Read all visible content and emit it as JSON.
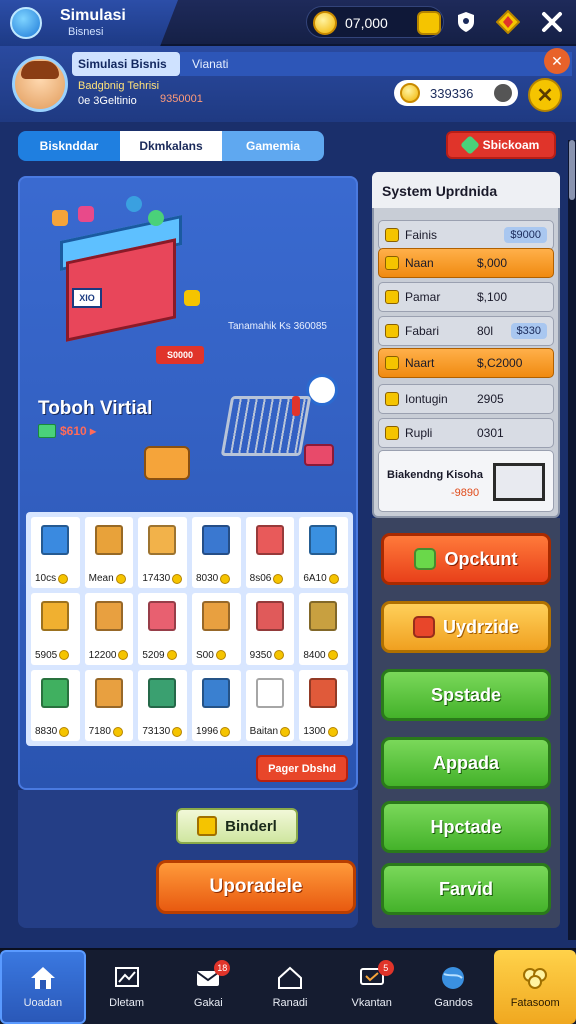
{
  "header": {
    "app_title": "Simulasi",
    "app_subtitle": "Bisnesi",
    "coins": "07,000",
    "icons": [
      "gold-coin-icon",
      "shield-icon",
      "chevron-badge-icon",
      "settings-cross-icon"
    ]
  },
  "profile": {
    "name": "Simulasi Bisnis",
    "tab_label": "Vianati",
    "line1": "Badgbnig Tehrisi",
    "line2": "0e 3Geltinio",
    "money": "9350001",
    "gems": "339336"
  },
  "tabs": [
    {
      "label": "Bisknddar",
      "state": "active"
    },
    {
      "label": "Dkmkalans",
      "state": "normal"
    },
    {
      "label": "Gamemia",
      "state": "normal"
    }
  ],
  "store_button": "Sbickoam",
  "main": {
    "shop_sign": "XIO",
    "price_tag": "S0000",
    "caption": "Tanamahik Ks 360085",
    "headline": "Toboh Virtial",
    "headline_sub": "$610 ▸",
    "grid": [
      {
        "label": "10cs",
        "color": "#3a8ae0"
      },
      {
        "label": "Mean",
        "color": "#e8a23a"
      },
      {
        "label": "17430",
        "color": "#f2b24a"
      },
      {
        "label": "8030",
        "color": "#3a78d0"
      },
      {
        "label": "8s06",
        "color": "#e85a5a"
      },
      {
        "label": "6A10",
        "color": "#3a90e0"
      },
      {
        "label": "5905",
        "color": "#f0b030"
      },
      {
        "label": "12200",
        "color": "#e8a040"
      },
      {
        "label": "5209",
        "color": "#e86070"
      },
      {
        "label": "S00",
        "color": "#e8a040"
      },
      {
        "label": "9350",
        "color": "#e05a5a"
      },
      {
        "label": "8400",
        "color": "#c8a040"
      },
      {
        "label": "8830",
        "color": "#40b060"
      },
      {
        "label": "7180",
        "color": "#e8a040"
      },
      {
        "label": "73130",
        "color": "#3aa070"
      },
      {
        "label": "1996",
        "color": "#3a80d0"
      },
      {
        "label": "Baitan",
        "color": "#ffffff"
      },
      {
        "label": "1300",
        "color": "#e05a3a"
      }
    ],
    "pager_button": "Pager Dbshd",
    "binder_button": "Binderl",
    "upgrade_button": "Uporadele"
  },
  "side": {
    "title": "System Uprdnida",
    "rows": [
      {
        "name": "Fainis",
        "amount": "",
        "chip": "$9000",
        "style": "gray"
      },
      {
        "name": "Naan",
        "amount": "$,000",
        "chip": "",
        "style": "orange"
      },
      {
        "name": "Pamar",
        "amount": "$,100",
        "chip": "",
        "style": "gray"
      },
      {
        "name": "Fabari",
        "amount": "80l",
        "chip": "$330",
        "style": "gray"
      },
      {
        "name": "Naart",
        "amount": "$,C2000",
        "chip": "",
        "style": "orange"
      },
      {
        "name": "Iontugin",
        "amount": "2905",
        "chip": "",
        "style": "gray"
      },
      {
        "name": "Rupli",
        "amount": "0301",
        "chip": "",
        "style": "gray"
      }
    ],
    "card_title": "Biakendng Kisoha",
    "card_value": "-9890"
  },
  "actions": [
    {
      "label": "Opckunt",
      "style": "red",
      "icon_color": "#6ad84a"
    },
    {
      "label": "Uydrzide",
      "style": "orange",
      "icon_color": "#e8462a"
    },
    {
      "label": "Spstade",
      "style": "green",
      "icon_color": ""
    },
    {
      "label": "Appada",
      "style": "green",
      "icon_color": ""
    },
    {
      "label": "Hpctade",
      "style": "green",
      "icon_color": ""
    },
    {
      "label": "Farvid",
      "style": "green",
      "icon_color": ""
    }
  ],
  "bottom_nav": [
    {
      "label": "Uoadan",
      "icon": "home-icon",
      "state": "active-blue",
      "badge": ""
    },
    {
      "label": "Dletam",
      "icon": "chart-board-icon",
      "state": "normal",
      "badge": ""
    },
    {
      "label": "Gakai",
      "icon": "mail-icon",
      "state": "normal",
      "badge": "18"
    },
    {
      "label": "Ranadi",
      "icon": "house-outline-icon",
      "state": "normal",
      "badge": ""
    },
    {
      "label": "Vkantan",
      "icon": "message-icon",
      "state": "normal",
      "badge": "5"
    },
    {
      "label": "Gandos",
      "icon": "globe-icon",
      "state": "normal",
      "badge": ""
    },
    {
      "label": "Fatasoom",
      "icon": "trophy-icon",
      "state": "active-gold",
      "badge": ""
    }
  ],
  "colors": {
    "accent": "#1f7fe0",
    "danger": "#e0342a",
    "upgrade": "#e85a10",
    "success": "#44b22a",
    "gold": "#f5c400"
  }
}
